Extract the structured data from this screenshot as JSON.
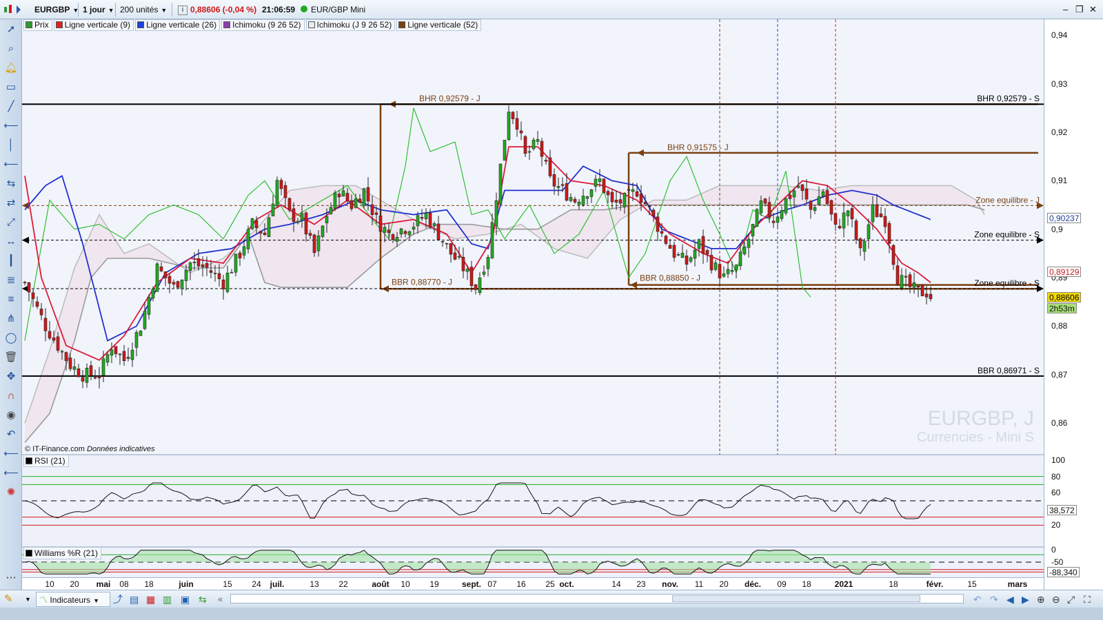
{
  "topbar": {
    "symbol": "EURGBP",
    "period": "1 jour",
    "units": "200 unités",
    "price_change": "0,88606 (-0,04 %)",
    "time": "21:06:59",
    "instrument": "EUR/GBP Mini"
  },
  "legend": [
    {
      "label": "Prix",
      "color": "#2e9b2e"
    },
    {
      "label": "Ligne verticale (9)",
      "color": "#e02020"
    },
    {
      "label": "Ligne verticale (26)",
      "color": "#2040d8"
    },
    {
      "label": "Ichimoku (9 26 52)",
      "color": "#8a3fb0"
    },
    {
      "label": "Ichimoku (J 9 26 52)",
      "color": "#e8ecf0"
    },
    {
      "label": "Ligne verticale (52)",
      "color": "#7a3f10"
    }
  ],
  "chart_data": {
    "type": "candlestick",
    "symbol": "EURGBP, J",
    "subtitle": "Currencies - Mini S",
    "y_ticks": [
      "0,94",
      "0,93",
      "0,92",
      "0,91",
      "0,9",
      "0,89",
      "0,88",
      "0,87",
      "0,86"
    ],
    "ylim": [
      0.8535,
      0.9433
    ],
    "x_labels": [
      {
        "label": "10",
        "i": 6
      },
      {
        "label": "20",
        "i": 12
      },
      {
        "label": "mai",
        "i": 19,
        "bold": true
      },
      {
        "label": "08",
        "i": 24
      },
      {
        "label": "18",
        "i": 30
      },
      {
        "label": "juin",
        "i": 39,
        "bold": true
      },
      {
        "label": "15",
        "i": 49
      },
      {
        "label": "24",
        "i": 56
      },
      {
        "label": "juil.",
        "i": 61,
        "bold": true
      },
      {
        "label": "13",
        "i": 70
      },
      {
        "label": "22",
        "i": 77
      },
      {
        "label": "août",
        "i": 86,
        "bold": true
      },
      {
        "label": "10",
        "i": 92
      },
      {
        "label": "19",
        "i": 99
      },
      {
        "label": "sept.",
        "i": 108,
        "bold": true
      },
      {
        "label": "07",
        "i": 113
      },
      {
        "label": "16",
        "i": 120
      },
      {
        "label": "25",
        "i": 127
      },
      {
        "label": "oct.",
        "i": 131,
        "bold": true
      },
      {
        "label": "14",
        "i": 143
      },
      {
        "label": "23",
        "i": 149
      },
      {
        "label": "nov.",
        "i": 156,
        "bold": true
      },
      {
        "label": "11",
        "i": 163
      },
      {
        "label": "20",
        "i": 169
      },
      {
        "label": "déc.",
        "i": 176,
        "bold": true
      },
      {
        "label": "09",
        "i": 183
      },
      {
        "label": "18",
        "i": 189
      },
      {
        "label": "2021",
        "i": 198,
        "bold": true
      },
      {
        "label": "18",
        "i": 210
      },
      {
        "label": "févr.",
        "i": 220,
        "bold": true
      },
      {
        "label": "15",
        "i": 229
      },
      {
        "label": "mars",
        "i": 240,
        "bold": true
      }
    ],
    "close_anchors": [
      [
        0,
        0.889
      ],
      [
        5,
        0.88
      ],
      [
        8,
        0.876
      ],
      [
        11,
        0.872
      ],
      [
        14,
        0.87
      ],
      [
        18,
        0.87
      ],
      [
        21,
        0.876
      ],
      [
        24,
        0.873
      ],
      [
        28,
        0.88
      ],
      [
        32,
        0.892
      ],
      [
        36,
        0.888
      ],
      [
        40,
        0.893
      ],
      [
        44,
        0.892
      ],
      [
        48,
        0.889
      ],
      [
        52,
        0.895
      ],
      [
        55,
        0.901
      ],
      [
        58,
        0.899
      ],
      [
        61,
        0.91
      ],
      [
        64,
        0.903
      ],
      [
        67,
        0.902
      ],
      [
        70,
        0.895
      ],
      [
        73,
        0.903
      ],
      [
        76,
        0.908
      ],
      [
        79,
        0.905
      ],
      [
        82,
        0.908
      ],
      [
        85,
        0.902
      ],
      [
        88,
        0.899
      ],
      [
        91,
        0.9
      ],
      [
        94,
        0.901
      ],
      [
        97,
        0.903
      ],
      [
        100,
        0.899
      ],
      [
        103,
        0.895
      ],
      [
        106,
        0.892
      ],
      [
        109,
        0.888
      ],
      [
        112,
        0.895
      ],
      [
        115,
        0.913
      ],
      [
        117,
        0.925
      ],
      [
        119,
        0.922
      ],
      [
        121,
        0.915
      ],
      [
        124,
        0.918
      ],
      [
        127,
        0.91
      ],
      [
        130,
        0.908
      ],
      [
        133,
        0.906
      ],
      [
        136,
        0.908
      ],
      [
        139,
        0.91
      ],
      [
        142,
        0.905
      ],
      [
        145,
        0.906
      ],
      [
        148,
        0.908
      ],
      [
        151,
        0.904
      ],
      [
        154,
        0.899
      ],
      [
        157,
        0.895
      ],
      [
        160,
        0.893
      ],
      [
        163,
        0.897
      ],
      [
        166,
        0.893
      ],
      [
        169,
        0.89
      ],
      [
        172,
        0.892
      ],
      [
        175,
        0.898
      ],
      [
        178,
        0.905
      ],
      [
        181,
        0.902
      ],
      [
        184,
        0.906
      ],
      [
        187,
        0.909
      ],
      [
        190,
        0.904
      ],
      [
        193,
        0.908
      ],
      [
        196,
        0.9
      ],
      [
        199,
        0.904
      ],
      [
        202,
        0.895
      ],
      [
        205,
        0.904
      ],
      [
        208,
        0.902
      ],
      [
        211,
        0.89
      ],
      [
        214,
        0.888
      ],
      [
        216,
        0.887
      ],
      [
        218,
        0.887
      ],
      [
        219,
        0.8861
      ]
    ],
    "last_index": 219,
    "total_slots": 243,
    "tenkan_anchors": [
      [
        0,
        0.911
      ],
      [
        4,
        0.89
      ],
      [
        10,
        0.876
      ],
      [
        18,
        0.873
      ],
      [
        24,
        0.878
      ],
      [
        32,
        0.889
      ],
      [
        40,
        0.894
      ],
      [
        48,
        0.893
      ],
      [
        56,
        0.902
      ],
      [
        62,
        0.905
      ],
      [
        70,
        0.901
      ],
      [
        78,
        0.906
      ],
      [
        86,
        0.901
      ],
      [
        94,
        0.902
      ],
      [
        102,
        0.899
      ],
      [
        108,
        0.891
      ],
      [
        113,
        0.898
      ],
      [
        117,
        0.917
      ],
      [
        124,
        0.917
      ],
      [
        132,
        0.91
      ],
      [
        140,
        0.909
      ],
      [
        148,
        0.906
      ],
      [
        156,
        0.899
      ],
      [
        164,
        0.895
      ],
      [
        170,
        0.893
      ],
      [
        176,
        0.9
      ],
      [
        182,
        0.905
      ],
      [
        188,
        0.91
      ],
      [
        194,
        0.909
      ],
      [
        200,
        0.905
      ],
      [
        206,
        0.9
      ],
      [
        212,
        0.893
      ],
      [
        216,
        0.891
      ],
      [
        219,
        0.889
      ]
    ],
    "kijun_anchors": [
      [
        0,
        0.904
      ],
      [
        5,
        0.909
      ],
      [
        9,
        0.911
      ],
      [
        14,
        0.897
      ],
      [
        20,
        0.877
      ],
      [
        27,
        0.88
      ],
      [
        34,
        0.891
      ],
      [
        42,
        0.895
      ],
      [
        50,
        0.896
      ],
      [
        58,
        0.9
      ],
      [
        64,
        0.901
      ],
      [
        72,
        0.903
      ],
      [
        80,
        0.906
      ],
      [
        86,
        0.904
      ],
      [
        94,
        0.903
      ],
      [
        102,
        0.904
      ],
      [
        108,
        0.897
      ],
      [
        112,
        0.896
      ],
      [
        116,
        0.908
      ],
      [
        122,
        0.908
      ],
      [
        130,
        0.908
      ],
      [
        135,
        0.913
      ],
      [
        142,
        0.91
      ],
      [
        148,
        0.909
      ],
      [
        154,
        0.9
      ],
      [
        160,
        0.898
      ],
      [
        166,
        0.896
      ],
      [
        172,
        0.896
      ],
      [
        178,
        0.902
      ],
      [
        184,
        0.904
      ],
      [
        188,
        0.905
      ],
      [
        194,
        0.907
      ],
      [
        200,
        0.908
      ],
      [
        206,
        0.907
      ],
      [
        210,
        0.905
      ],
      [
        216,
        0.903
      ],
      [
        219,
        0.902
      ]
    ],
    "chikou_anchors": [
      [
        0,
        0.877
      ],
      [
        2,
        0.887
      ],
      [
        6,
        0.906
      ],
      [
        12,
        0.9
      ],
      [
        18,
        0.901
      ],
      [
        24,
        0.898
      ],
      [
        30,
        0.903
      ],
      [
        36,
        0.905
      ],
      [
        42,
        0.903
      ],
      [
        48,
        0.898
      ],
      [
        54,
        0.907
      ],
      [
        58,
        0.91
      ],
      [
        64,
        0.902
      ],
      [
        70,
        0.905
      ],
      [
        78,
        0.909
      ],
      [
        84,
        0.902
      ],
      [
        88,
        0.898
      ],
      [
        92,
        0.913
      ],
      [
        94,
        0.925
      ],
      [
        98,
        0.916
      ],
      [
        104,
        0.918
      ],
      [
        108,
        0.903
      ],
      [
        112,
        0.904
      ],
      [
        116,
        0.898
      ],
      [
        122,
        0.905
      ],
      [
        128,
        0.895
      ],
      [
        134,
        0.899
      ],
      [
        140,
        0.908
      ],
      [
        146,
        0.89
      ],
      [
        150,
        0.895
      ],
      [
        156,
        0.91
      ],
      [
        160,
        0.915
      ],
      [
        164,
        0.906
      ],
      [
        168,
        0.899
      ],
      [
        172,
        0.891
      ],
      [
        176,
        0.904
      ],
      [
        180,
        0.902
      ],
      [
        184,
        0.912
      ],
      [
        188,
        0.888
      ],
      [
        190,
        0.886
      ]
    ],
    "span_a_anchors": [
      [
        0,
        0.86
      ],
      [
        6,
        0.875
      ],
      [
        12,
        0.892
      ],
      [
        18,
        0.903
      ],
      [
        24,
        0.895
      ],
      [
        30,
        0.897
      ],
      [
        40,
        0.891
      ],
      [
        48,
        0.894
      ],
      [
        56,
        0.9
      ],
      [
        64,
        0.908
      ],
      [
        72,
        0.909
      ],
      [
        80,
        0.909
      ],
      [
        88,
        0.905
      ],
      [
        96,
        0.901
      ],
      [
        104,
        0.898
      ],
      [
        112,
        0.899
      ],
      [
        120,
        0.901
      ],
      [
        128,
        0.896
      ],
      [
        136,
        0.894
      ],
      [
        144,
        0.902
      ],
      [
        152,
        0.906
      ],
      [
        160,
        0.906
      ],
      [
        168,
        0.909
      ],
      [
        176,
        0.909
      ],
      [
        184,
        0.909
      ],
      [
        192,
        0.908
      ],
      [
        200,
        0.909
      ],
      [
        208,
        0.909
      ],
      [
        216,
        0.909
      ],
      [
        224,
        0.909
      ],
      [
        230,
        0.906
      ],
      [
        232,
        0.903
      ]
    ],
    "span_b_anchors": [
      [
        0,
        0.856
      ],
      [
        6,
        0.862
      ],
      [
        12,
        0.877
      ],
      [
        16,
        0.89
      ],
      [
        20,
        0.894
      ],
      [
        30,
        0.894
      ],
      [
        40,
        0.892
      ],
      [
        48,
        0.892
      ],
      [
        54,
        0.899
      ],
      [
        58,
        0.889
      ],
      [
        62,
        0.888
      ],
      [
        70,
        0.888
      ],
      [
        78,
        0.888
      ],
      [
        86,
        0.894
      ],
      [
        94,
        0.899
      ],
      [
        100,
        0.901
      ],
      [
        108,
        0.901
      ],
      [
        116,
        0.9
      ],
      [
        124,
        0.9
      ],
      [
        132,
        0.904
      ],
      [
        140,
        0.904
      ],
      [
        148,
        0.905
      ],
      [
        156,
        0.905
      ],
      [
        164,
        0.905
      ],
      [
        172,
        0.905
      ],
      [
        180,
        0.905
      ],
      [
        188,
        0.905
      ],
      [
        196,
        0.905
      ],
      [
        204,
        0.905
      ],
      [
        212,
        0.905
      ],
      [
        220,
        0.905
      ],
      [
        228,
        0.905
      ],
      [
        232,
        0.904
      ]
    ],
    "levels": [
      {
        "price": 0.92579,
        "label": "BHR 0,92579 - S",
        "style": "solid",
        "color": "#000000",
        "width": 2
      },
      {
        "price": 0.86971,
        "label": "BBR 0,86971 - S",
        "style": "solid",
        "color": "#000000",
        "width": 2
      },
      {
        "price": 0.90489,
        "label": "Zone equilibre - J",
        "style": "dashed",
        "color": "#7a3f10",
        "width": 1
      },
      {
        "price": 0.89775,
        "label": "Zone equilibre - S",
        "style": "dashed",
        "color": "#000000",
        "width": 1
      },
      {
        "price": 0.88775,
        "label": "Zone equilibre - S",
        "style": "dashed",
        "color": "#000000",
        "width": 1
      }
    ],
    "boxes": [
      {
        "i0": 86,
        "i1": 245,
        "top": 0.92579,
        "bottom": 0.8877,
        "top_label": "BHR 0,92579 - J",
        "bottom_label": "BBR 0,88770 - J"
      },
      {
        "i0": 146,
        "i1": 245,
        "top": 0.91575,
        "bottom": 0.8885,
        "top_label": "BHR 0,91575 - J",
        "bottom_label": "BBR 0,88850 - J"
      }
    ],
    "vlines": [
      {
        "i": 168,
        "color": "#7a3f10"
      },
      {
        "i": 182,
        "color": "#2040d8"
      },
      {
        "i": 196,
        "color": "#e02020"
      }
    ],
    "price_tags": [
      {
        "price": 0.90237,
        "label": "0,90237",
        "bg": "#ffffff",
        "fg": "#1f3c9a"
      },
      {
        "price": 0.89129,
        "label": "0,89129",
        "bg": "#ffffff",
        "fg": "#c81818"
      },
      {
        "price": 0.88606,
        "label": "0,88606",
        "bg": "#f2d800",
        "fg": "#000000"
      }
    ],
    "countdown": "2h53m",
    "rsi": {
      "name": "RSI (21)",
      "value_label": "38,572",
      "ticks": [
        "100",
        "80",
        "60",
        "40",
        "20"
      ]
    },
    "williams": {
      "name": "Williams %R (21)",
      "value_label": "-88,340",
      "ticks": [
        "0",
        "-50"
      ]
    }
  },
  "footer": {
    "copyright": "© IT-Finance.com",
    "note": "Données indicatives"
  },
  "bottombar": {
    "indicators_label": "Indicateurs"
  }
}
